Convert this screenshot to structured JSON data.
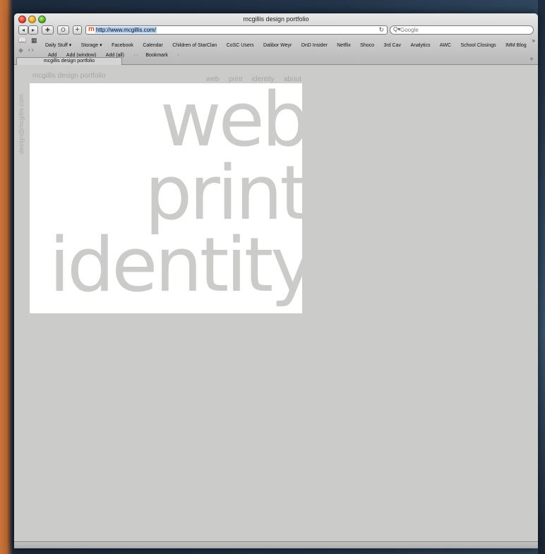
{
  "window": {
    "title": "mcgillis design portfolio"
  },
  "toolbar": {
    "back_label": "◂",
    "forward_label": "▸",
    "button_a_label": "✚",
    "button_b_label": "O",
    "add_button_label": "+",
    "url_favicon": "m",
    "url": "http://www.mcgillis.com/",
    "reload_icon": "↻",
    "search_icon": "Q▾",
    "search_placeholder": "Google"
  },
  "bookmarks": {
    "book_icon": "📖",
    "grid_icon": "▦",
    "items": [
      "Daily Stuff ▾",
      "Storage ▾",
      "Facebook",
      "Calendar",
      "Children of StarClan",
      "CoSC Users",
      "Dalibor Weyr",
      "DnD Insider",
      "Netflix",
      "Shoco",
      "3rd Cav",
      "Analytics",
      "AWC",
      "School Closings",
      "IMM Blog"
    ],
    "more_label": "»"
  },
  "secondary_toolbar": {
    "arrows_label": "‹ ›",
    "items": [
      "Add",
      "Add (window)",
      "Add (all)"
    ],
    "separator": "› ‹",
    "bookmark_label": "Bookmark",
    "end_separator": "›"
  },
  "tabs": [
    {
      "label": "mcgillis design portfolio"
    }
  ],
  "tab_add_label": "+",
  "page": {
    "site_title": "mcgillis design portfolio",
    "nav": [
      "web",
      "print",
      "identity",
      "about"
    ],
    "side_email": "design@mcgillis.com",
    "hero_words": [
      "web",
      "print",
      "identity"
    ]
  },
  "colors": {
    "page_background": "#cbcbca",
    "hero_background": "#ffffff",
    "hero_text": "#cbcbca",
    "nav_text": "#a6a6a6"
  }
}
